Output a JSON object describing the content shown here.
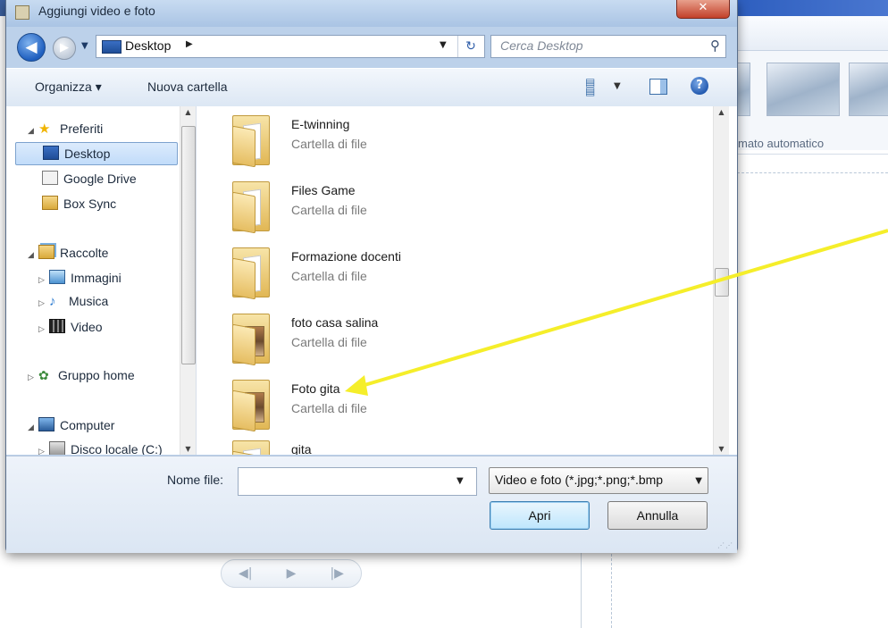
{
  "dialog": {
    "title": "Aggiungi video e foto",
    "close_label": "✕"
  },
  "navigation": {
    "back_glyph": "◀",
    "forward_glyph": "▶",
    "address": {
      "label": "Desktop",
      "icon": "desktop-icon"
    },
    "search": {
      "placeholder": "Cerca Desktop",
      "icon": "search-icon"
    }
  },
  "toolbar": {
    "organize_label": "Organizza ▾",
    "new_folder_label": "Nuova cartella",
    "view_icon": "view-options-icon",
    "preview_icon": "preview-pane-icon",
    "help_label": "?"
  },
  "nav_pane": {
    "favorites": {
      "label": "Preferiti",
      "icon": "star-icon"
    },
    "favorites_items": [
      {
        "label": "Desktop",
        "icon": "desktop-icon",
        "selected": true
      },
      {
        "label": "Google Drive",
        "icon": "google-drive-icon"
      },
      {
        "label": "Box Sync",
        "icon": "folder-icon"
      }
    ],
    "libraries": {
      "label": "Raccolte",
      "icon": "library-icon"
    },
    "libraries_items": [
      {
        "label": "Immagini",
        "icon": "pictures-icon"
      },
      {
        "label": "Musica",
        "icon": "music-icon"
      },
      {
        "label": "Video",
        "icon": "video-icon"
      }
    ],
    "homegroup": {
      "label": "Gruppo home",
      "icon": "homegroup-icon"
    },
    "computer": {
      "label": "Computer",
      "icon": "computer-icon"
    },
    "computer_items": [
      {
        "label": "Disco locale (C:)",
        "icon": "disk-icon"
      }
    ]
  },
  "files": [
    {
      "name": "E-twinning",
      "type": "Cartella di file",
      "icon": "folder-icon"
    },
    {
      "name": "Files Game",
      "type": "Cartella di file",
      "icon": "folder-icon"
    },
    {
      "name": "Formazione docenti",
      "type": "Cartella di file",
      "icon": "folder-icon"
    },
    {
      "name": "foto casa salina",
      "type": "Cartella di file",
      "icon": "photo-folder-icon"
    },
    {
      "name": "Foto gita",
      "type": "Cartella di file",
      "icon": "photo-folder-icon"
    },
    {
      "name": "gita",
      "type": "",
      "icon": "folder-icon"
    }
  ],
  "bottom": {
    "filename_label": "Nome file:",
    "filename_value": "",
    "filetype_value": "Video e foto (*.jpg;*.png;*.bmp",
    "open_label": "Apri",
    "cancel_label": "Annulla"
  },
  "background_app": {
    "ribbon_label": "mato automatico",
    "player_glyphs": [
      "◀|",
      "▶",
      "|▶"
    ]
  },
  "annotation": {
    "color": "#f5ee2a"
  }
}
